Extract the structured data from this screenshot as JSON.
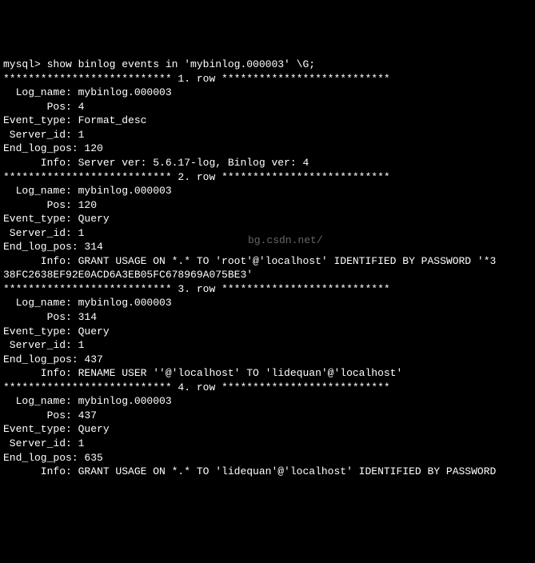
{
  "prompt": "mysql> show binlog events in 'mybinlog.000003' \\G;",
  "rows": [
    {
      "sep": "*************************** 1. row ***************************",
      "fields": [
        "  Log_name: mybinlog.000003",
        "       Pos: 4",
        "Event_type: Format_desc",
        " Server_id: 1",
        "End_log_pos: 120",
        "      Info: Server ver: 5.6.17-log, Binlog ver: 4"
      ]
    },
    {
      "sep": "*************************** 2. row ***************************",
      "fields": [
        "  Log_name: mybinlog.000003",
        "       Pos: 120",
        "Event_type: Query",
        " Server_id: 1",
        "End_log_pos: 314",
        "      Info: GRANT USAGE ON *.* TO 'root'@'localhost' IDENTIFIED BY PASSWORD '*3",
        "38FC2638EF92E0ACD6A3EB05FC678969A075BE3'"
      ]
    },
    {
      "sep": "*************************** 3. row ***************************",
      "fields": [
        "  Log_name: mybinlog.000003",
        "       Pos: 314",
        "Event_type: Query",
        " Server_id: 1",
        "End_log_pos: 437",
        "      Info: RENAME USER ''@'localhost' TO 'lidequan'@'localhost'"
      ]
    },
    {
      "sep": "*************************** 4. row ***************************",
      "fields": [
        "  Log_name: mybinlog.000003",
        "       Pos: 437",
        "Event_type: Query",
        " Server_id: 1",
        "End_log_pos: 635",
        "      Info: GRANT USAGE ON *.* TO 'lidequan'@'localhost' IDENTIFIED BY PASSWORD"
      ]
    }
  ],
  "watermark": "bg.csdn.net/"
}
